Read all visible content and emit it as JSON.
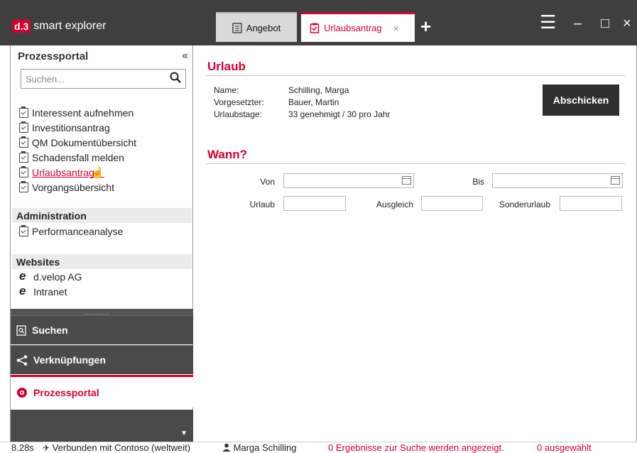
{
  "app": {
    "logo_mark": "d.3",
    "logo_text": "smart explorer"
  },
  "tabs": [
    {
      "label": "Angebot",
      "icon": "document-icon"
    },
    {
      "label": "Urlaubsantrag",
      "icon": "clipboard-icon",
      "close": "×"
    }
  ],
  "window": {
    "menu": "☰",
    "minimize": "–",
    "maximize": "□",
    "close": "×",
    "add_tab": "+"
  },
  "sidebar": {
    "title": "Prozessportal",
    "collapse": "«",
    "search_placeholder": "Suchen...",
    "process_items": [
      {
        "label": "Interessent aufnehmen"
      },
      {
        "label": "Investitionsantrag"
      },
      {
        "label": "QM Dokumentübersicht"
      },
      {
        "label": "Schadensfall melden"
      },
      {
        "label": "Urlaubsantrag",
        "active": true
      },
      {
        "label": "Vorgangsübersicht"
      }
    ],
    "admin_title": "Administration",
    "admin_items": [
      {
        "label": "Performanceanalyse"
      }
    ],
    "websites_title": "Websites",
    "website_items": [
      {
        "label": "d.velop AG"
      },
      {
        "label": "Intranet"
      }
    ],
    "grip": "...........",
    "nav": [
      {
        "label": "Suchen",
        "icon": "search-doc-icon"
      },
      {
        "label": "Verknüpfungen",
        "icon": "share-icon"
      },
      {
        "label": "Prozessportal",
        "icon": "process-icon",
        "active": true
      }
    ],
    "more_caret": "▼"
  },
  "main": {
    "urlaub_title": "Urlaub",
    "info": [
      {
        "label": "Name:",
        "value": "Schilling, Marga"
      },
      {
        "label": "Vorgesetzter:",
        "value": "Bauer, Martin"
      },
      {
        "label": "Urlaubstage:",
        "value": "33 genehmigt / 30 pro Jahr"
      }
    ],
    "submit_label": "Abschicken",
    "wann_title": "Wann?",
    "form": {
      "von": "Von",
      "bis": "Bis",
      "urlaub": "Urlaub",
      "ausgleich": "Ausgleich",
      "sonderurlaub": "Sonderurlaub"
    }
  },
  "status": {
    "time": "8.28s",
    "connection": "Verbunden mit Contoso (weltweit)",
    "user": "Marga Schilling",
    "results": "0 Ergebnisse zur Suche werden angezeigt.",
    "selected": "0 ausgewählt"
  },
  "colors": {
    "accent": "#d50032",
    "titlebar": "#3f3f3f",
    "nav_bg": "#4a4a4a"
  }
}
